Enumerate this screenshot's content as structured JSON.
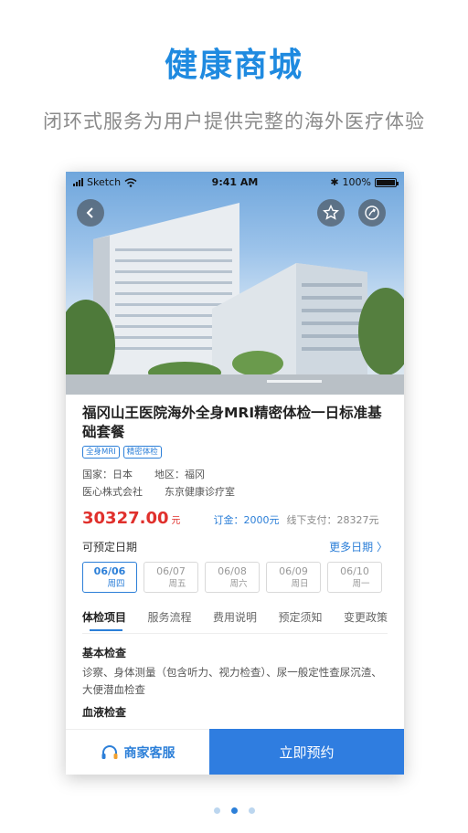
{
  "hero": {
    "title": "健康商城",
    "subtitle": "闭环式服务为用户提供完整的海外医疗体验"
  },
  "status_bar": {
    "carrier": "Sketch",
    "time": "9:41 AM",
    "battery": "100%"
  },
  "product": {
    "title": "福冈山王医院海外全身MRI精密体检一日标准基础套餐",
    "tags": [
      "全身MRI",
      "精密体检"
    ],
    "country_label": "国家：日本",
    "region_label": "地区：福冈",
    "company": "医心株式会社",
    "clinic": "东京健康诊疗室",
    "price": "30327.00",
    "price_unit": "元",
    "deposit": "订金：2000元",
    "offline": "线下支付：28327元"
  },
  "dates": {
    "heading": "可预定日期",
    "more": "更多日期 〉",
    "items": [
      {
        "date": "06/06",
        "weekday": "周四"
      },
      {
        "date": "06/07",
        "weekday": "周五"
      },
      {
        "date": "06/08",
        "weekday": "周六"
      },
      {
        "date": "06/09",
        "weekday": "周日"
      },
      {
        "date": "06/10",
        "weekday": "周一"
      }
    ],
    "selected_index": 0
  },
  "tabs": [
    "体检项目",
    "服务流程",
    "费用说明",
    "预定须知",
    "变更政策"
  ],
  "content": {
    "section1_title": "基本检查",
    "section1_text": "诊察、身体测量（包含听力、视力检查）、尿一般定性查尿沉渣、大便潜血检查",
    "section2_title": "血液检查"
  },
  "bottom": {
    "service": "商家客服",
    "book": "立即预约"
  },
  "pager": {
    "count": 3,
    "active_index": 1
  },
  "colors": {
    "accent": "#2c7fd8",
    "price": "#e0302c",
    "button": "#2f7de0"
  }
}
